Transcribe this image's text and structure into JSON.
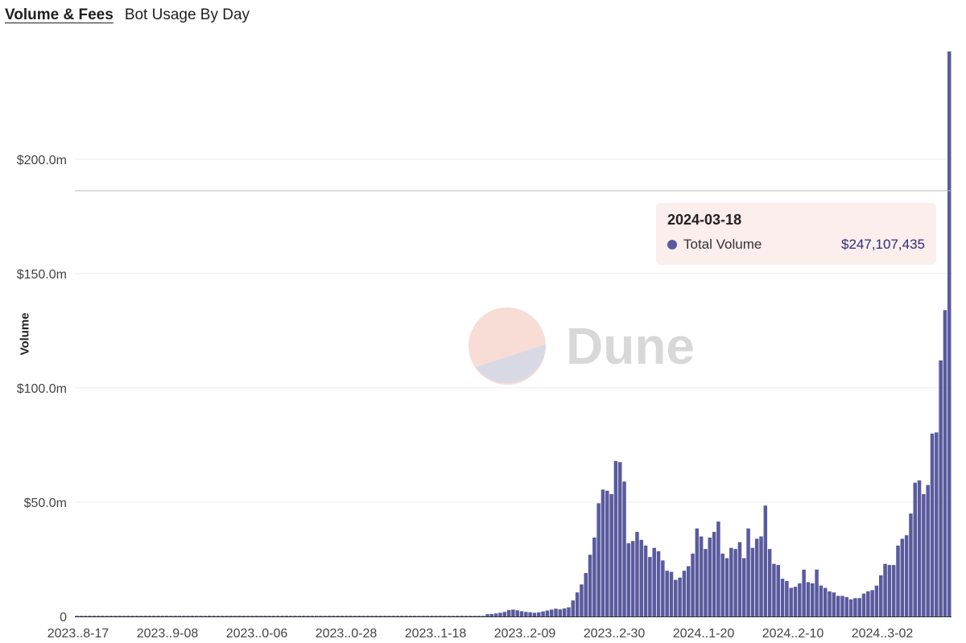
{
  "tabs": [
    {
      "label": "Volume & Fees",
      "active": true
    },
    {
      "label": "Bot Usage By Day",
      "active": false
    }
  ],
  "watermark": {
    "text": "Dune"
  },
  "tooltip": {
    "date": "2024-03-18",
    "series": "Total Volume",
    "value": "$247,107,435"
  },
  "chart_data": {
    "type": "bar",
    "ylabel": "Volume",
    "ylim": [
      0,
      247107435
    ],
    "yticks": [
      {
        "value": 0,
        "label": "0"
      },
      {
        "value": 50000000,
        "label": "$50.0m"
      },
      {
        "value": 100000000,
        "label": "$100.0m"
      },
      {
        "value": 150000000,
        "label": "$150.0m"
      },
      {
        "value": 200000000,
        "label": "$200.0m"
      }
    ],
    "xtick_labels": [
      "2023..8-17",
      "2023..9-08",
      "2023..0-06",
      "2023..0-28",
      "2023..1-18",
      "2023..2-09",
      "2023..2-30",
      "2024..1-20",
      "2024..2-10",
      "2024..3-02"
    ],
    "bar_color": "#5a5a9e",
    "series": [
      {
        "name": "Total Volume",
        "values": [
          0,
          0,
          0,
          0,
          0,
          0,
          0,
          0,
          0,
          0,
          0,
          0,
          0,
          0,
          0,
          0,
          0,
          0,
          0,
          0,
          0,
          0,
          0,
          0,
          0,
          0,
          0,
          0,
          0,
          0,
          0,
          0,
          0,
          0,
          0,
          0,
          0,
          0,
          0,
          0,
          0,
          0,
          0,
          0,
          0,
          0,
          0,
          0,
          0,
          0,
          0,
          0,
          0,
          0,
          0,
          0,
          0,
          0,
          0,
          0,
          0,
          0,
          0,
          0,
          0,
          0,
          0,
          0,
          0,
          0,
          0,
          0,
          0,
          0,
          0,
          0,
          0,
          0,
          0,
          0,
          0,
          0,
          0,
          0,
          0,
          0,
          0,
          0,
          0,
          0,
          0,
          0,
          0,
          0,
          0,
          0,
          1000000,
          1100000,
          1300000,
          1600000,
          2000000,
          2800000,
          3000000,
          2700000,
          2300000,
          2000000,
          1800000,
          1600000,
          1800000,
          2200000,
          2600000,
          3000000,
          3400000,
          3100000,
          3500000,
          4000000,
          7000000,
          10500000,
          14000000,
          19000000,
          27000000,
          34500000,
          49500000,
          55500000,
          55000000,
          53500000,
          68000000,
          67500000,
          59000000,
          32000000,
          33000000,
          37000000,
          33500000,
          31000000,
          26000000,
          30000000,
          28500000,
          24500000,
          20000000,
          19500000,
          16000000,
          17000000,
          20000000,
          22000000,
          27500000,
          38500000,
          35000000,
          29500000,
          34500000,
          37000000,
          41500000,
          27500000,
          25500000,
          30000000,
          29500000,
          32500000,
          25500000,
          38500000,
          30000000,
          34000000,
          35000000,
          48500000,
          29500000,
          23000000,
          22500000,
          16500000,
          15500000,
          12500000,
          13000000,
          14500000,
          20500000,
          15000000,
          14500000,
          20500000,
          13500000,
          12500000,
          11000000,
          10500000,
          9000000,
          9000000,
          8500000,
          7500000,
          8000000,
          8000000,
          10000000,
          11000000,
          11500000,
          13500000,
          18000000,
          23000000,
          22500000,
          22500000,
          31000000,
          34000000,
          35500000,
          45000000,
          58500000,
          59500000,
          53500000,
          57500000,
          80000000,
          80500000,
          112000000,
          134000000,
          247107435
        ]
      }
    ]
  }
}
